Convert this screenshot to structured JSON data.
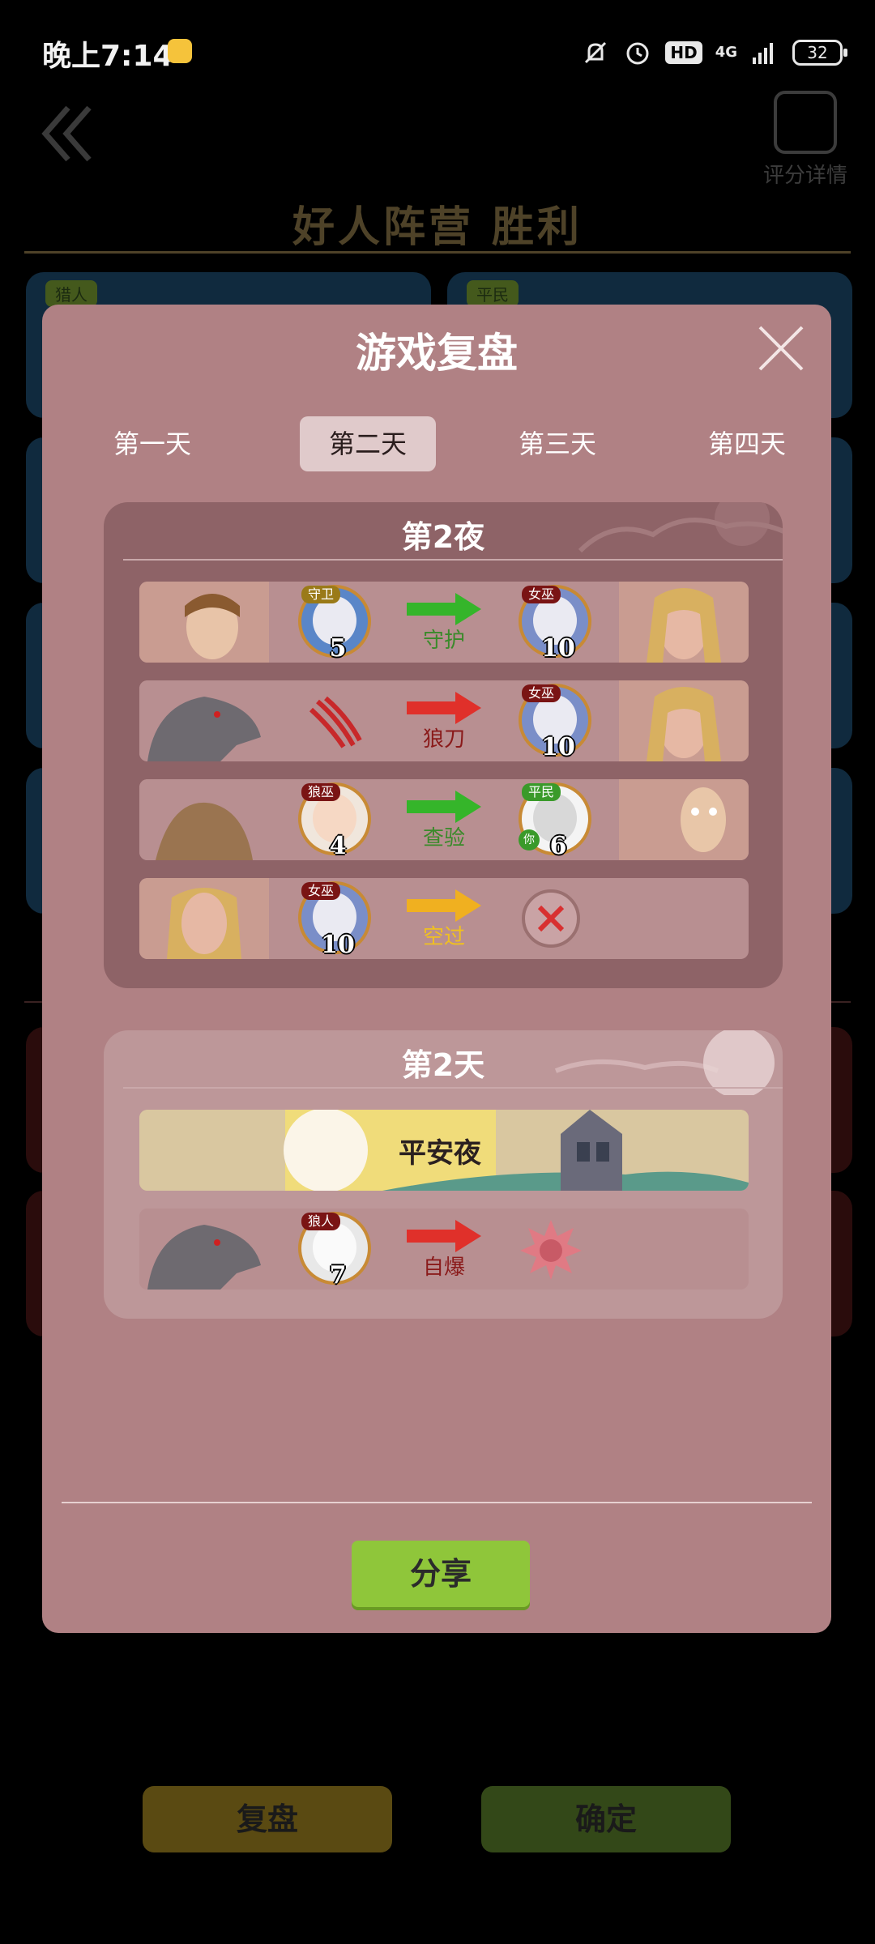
{
  "status_bar": {
    "time": "晚上7:14",
    "hd": "HD",
    "network": "4G",
    "battery": "32"
  },
  "background": {
    "score_label": "评分详情",
    "title": "好人阵营  胜利",
    "tag_left": "猎人",
    "tag_right": "平民",
    "btn_replay": "复盘",
    "btn_confirm": "确定"
  },
  "modal": {
    "title": "游戏复盘",
    "tabs": [
      "第一天",
      "第二天",
      "第三天",
      "第四天"
    ],
    "active_tab": 1,
    "night": {
      "title": "第2夜",
      "rows": [
        {
          "actor_role": "守卫",
          "actor_seat": "5",
          "action": "守护",
          "action_color": "#3a8a2a",
          "arrow": "green",
          "target_role": "女巫",
          "target_seat": "10"
        },
        {
          "actor_role": "",
          "actor_seat": "",
          "action": "狼刀",
          "action_color": "#8a1a1a",
          "arrow": "red",
          "target_role": "女巫",
          "target_seat": "10"
        },
        {
          "actor_role": "狼巫",
          "actor_seat": "4",
          "action": "查验",
          "action_color": "#3a8a2a",
          "arrow": "green",
          "target_role": "平民",
          "target_seat": "6",
          "target_you": "你"
        },
        {
          "actor_role": "女巫",
          "actor_seat": "10",
          "action": "空过",
          "action_color": "#f0c020",
          "arrow": "yellow",
          "target_role": "",
          "target_seat": ""
        }
      ]
    },
    "day": {
      "title": "第2天",
      "safe_night": "平安夜",
      "rows": [
        {
          "actor_role": "狼人",
          "actor_seat": "7",
          "action": "自爆",
          "action_color": "#8a1a1a",
          "arrow": "red"
        }
      ]
    },
    "share_label": "分享"
  },
  "colors": {
    "modal_bg": "#b08184",
    "night_panel": "#8e6367",
    "day_panel": "#bd9799",
    "arrow_green": "#35b52a",
    "arrow_red": "#e0302a",
    "arrow_yellow": "#f0b020",
    "share_button": "#8fc63a"
  },
  "icons": [
    "back-chevron-icon",
    "score-detail-icon",
    "close-icon",
    "claw-icon",
    "cross-icon",
    "explosion-icon",
    "bell-off-icon",
    "alarm-icon",
    "signal-icon",
    "battery-icon"
  ]
}
